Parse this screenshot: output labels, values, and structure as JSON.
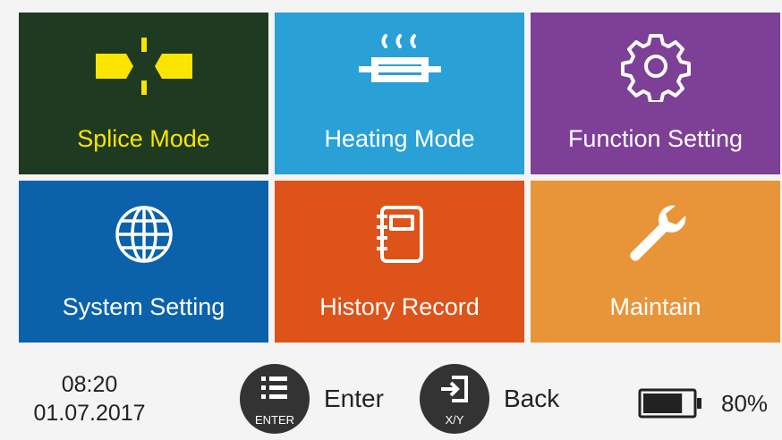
{
  "tiles": [
    {
      "label": "Splice Mode",
      "icon": "splice-icon",
      "color": "#1e3a20",
      "selected": true
    },
    {
      "label": "Heating Mode",
      "icon": "heater-icon",
      "color": "#29a0d6"
    },
    {
      "label": "Function Setting",
      "icon": "gear-icon",
      "color": "#7e3f96"
    },
    {
      "label": "System Setting",
      "icon": "globe-icon",
      "color": "#0b62aa"
    },
    {
      "label": "History Record",
      "icon": "notebook-icon",
      "color": "#dd5319"
    },
    {
      "label": "Maintain",
      "icon": "wrench-icon",
      "color": "#e8953a"
    }
  ],
  "status": {
    "time": "08:20",
    "date": "01.07.2017",
    "enter_caption": "ENTER",
    "enter_label": "Enter",
    "back_caption": "X/Y",
    "back_label": "Back",
    "battery_percent": "80%",
    "battery_level": 0.8
  },
  "colors": {
    "selected_text": "#fbe500",
    "background": "#f4f4f4",
    "button": "#333333"
  }
}
